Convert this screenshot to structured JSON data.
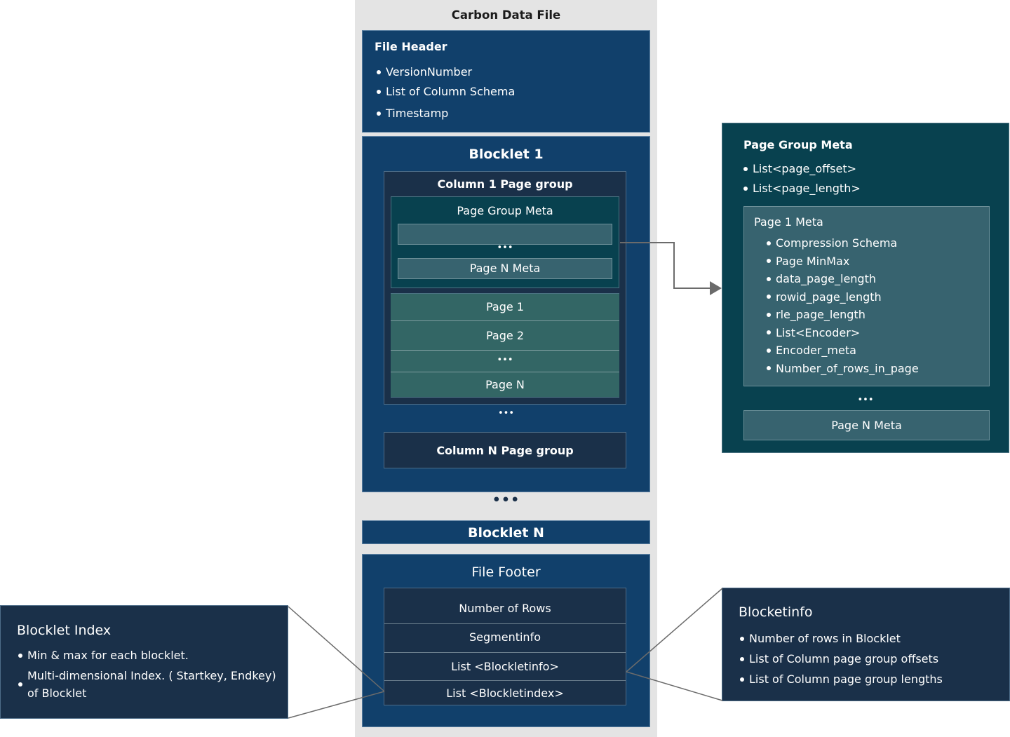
{
  "diagram": {
    "title": "Carbon Data File",
    "file_header": {
      "title": "File Header",
      "items": [
        "VersionNumber",
        "List of Column Schema",
        "Timestamp"
      ]
    },
    "blocklet1": {
      "title": "Blocklet 1",
      "column1": {
        "title": "Column 1 Page group",
        "page_group_meta": {
          "title": "Page Group Meta",
          "dots": "•••",
          "last": "Page N Meta"
        },
        "pages": [
          "Page 1",
          "Page 2",
          "•••",
          "Page N"
        ]
      },
      "dots": "•••",
      "columnN": "Column N Page group"
    },
    "between_dots": "•••",
    "blockletN": "Blocklet N",
    "file_footer": {
      "title": "File Footer",
      "rows": [
        "Number of Rows",
        "Segmentinfo",
        "List <Blockletinfo>",
        "List <Blockletindex>"
      ]
    },
    "page_group_meta_detail": {
      "title": "Page Group Meta",
      "items": [
        "List<page_offset>",
        "List<page_length>"
      ],
      "page1_meta": {
        "title": "Page 1 Meta",
        "items": [
          "Compression Schema",
          "Page MinMax",
          "data_page_length",
          "rowid_page_length",
          "rle_page_length",
          "List<Encoder>",
          "Encoder_meta",
          "Number_of_rows_in_page"
        ]
      },
      "dots": "•••",
      "pageN_meta": "Page N Meta"
    },
    "blocklet_index": {
      "title": "Blocklet Index",
      "items": [
        "Min & max for each blocklet.",
        "Multi-dimensional Index. ( Startkey, Endkey) of Blocklet"
      ]
    },
    "blockletinfo": {
      "title": "Blocketinfo",
      "items": [
        "Number of rows in Blocklet",
        "List of Column page group offsets",
        "List of Column page group lengths"
      ]
    }
  },
  "colors": {
    "file_background": "#e4e4e4",
    "navy_block": "#11406b",
    "dark_block": "#1a3049",
    "teal_block": "#08414f",
    "slate_block": "#37636f",
    "page_green": "#336665",
    "connector": "#6b6b6b"
  }
}
